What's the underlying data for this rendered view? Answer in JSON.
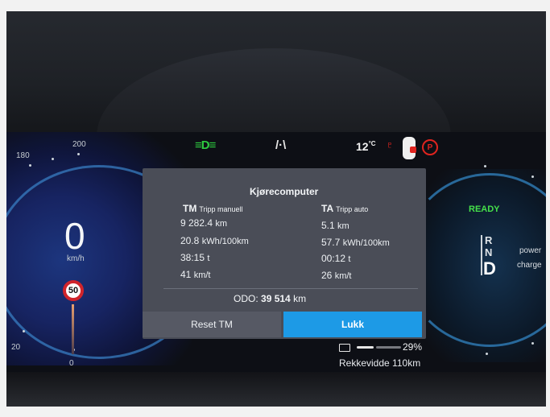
{
  "speed": {
    "value": "0",
    "unit": "km/h",
    "limit": "50"
  },
  "gauge_labels": {
    "l180": "180",
    "l200": "200",
    "l20": "20",
    "l0": "0"
  },
  "status": {
    "temperature_value": "12",
    "temperature_unit": "°C"
  },
  "trip_computer": {
    "title": "Kjørecomputer",
    "manual": {
      "code": "TM",
      "label": "Tripp manuell",
      "distance": "9 282.4",
      "distance_unit": "km",
      "consumption": "20.8",
      "consumption_unit": "kWh/100km",
      "time": "38:15",
      "time_unit": "t",
      "avg_speed": "41",
      "avg_speed_unit": "km/t"
    },
    "auto": {
      "code": "TA",
      "label": "Tripp auto",
      "distance": "5.1",
      "distance_unit": "km",
      "consumption": "57.7",
      "consumption_unit": "kWh/100km",
      "time": "00:12",
      "time_unit": "t",
      "avg_speed": "26",
      "avg_speed_unit": "km/t"
    },
    "odo_label": "ODO:",
    "odo_value": "39 514",
    "odo_unit": "km",
    "reset_label": "Reset TM",
    "close_label": "Lukk"
  },
  "drive": {
    "ready": "READY",
    "gear_r": "R",
    "gear_n": "N",
    "gear_d": "D",
    "power_label": "power",
    "charge_label": "charge"
  },
  "battery": {
    "percent": "29%",
    "level": 0.29,
    "range_label": "Rekkevidde",
    "range_value": "110",
    "range_unit": "km"
  },
  "icons": [
    "headlight-icon",
    "road-icon",
    "seatbelt-warning-icon",
    "car-door-icon",
    "parking-brake-icon",
    "battery-icon"
  ],
  "colors": {
    "accent_blue": "#1d9ae6",
    "ready_green": "#45e04a",
    "warning_red": "#e0241f"
  }
}
